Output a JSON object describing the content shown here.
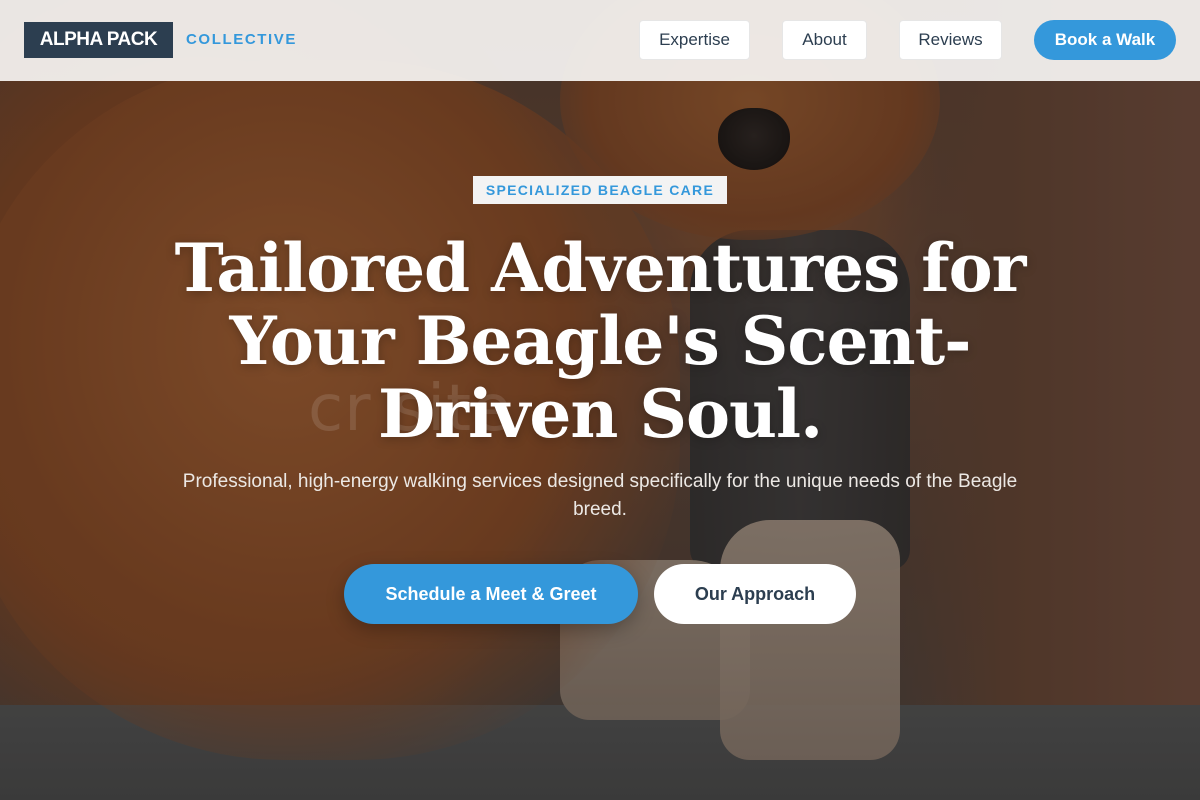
{
  "header": {
    "logo_main": "ALPHA PACK",
    "logo_sub": "COLLECTIVE",
    "nav": [
      {
        "label": "Expertise"
      },
      {
        "label": "About"
      },
      {
        "label": "Reviews"
      }
    ],
    "cta_label": "Book a Walk"
  },
  "hero": {
    "badge": "SPECIALIZED BEAGLE CARE",
    "headline": "Tailored Adventures for Your Beagle's Scent-Driven Soul.",
    "subtext": "Professional, high-energy walking services designed specifically for the unique needs of the Beagle breed.",
    "primary_button": "Schedule a Meet & Greet",
    "secondary_button": "Our Approach",
    "watermark": "cr            site"
  },
  "colors": {
    "accent": "#3498db",
    "navy": "#2c3e50",
    "header_bg": "#f6f4f2"
  }
}
